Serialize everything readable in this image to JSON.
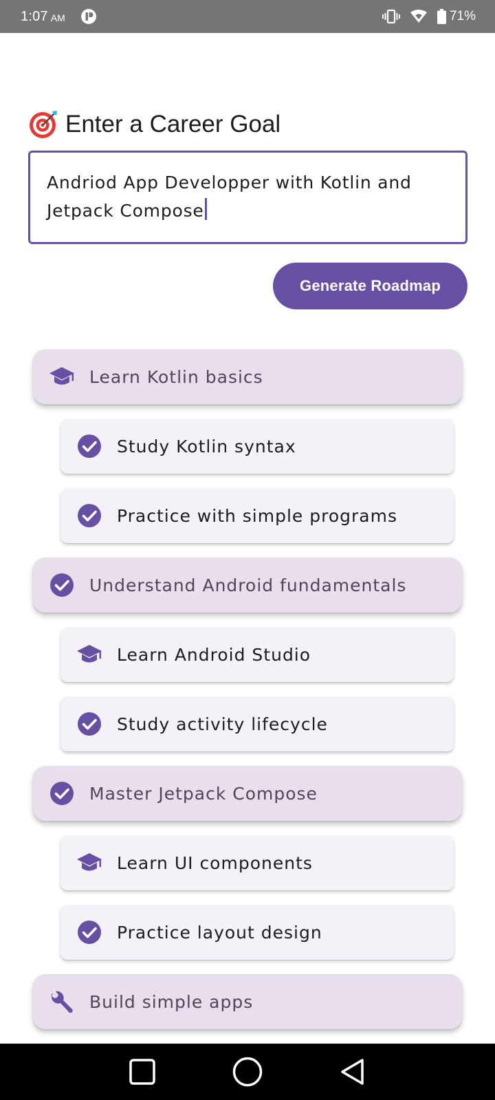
{
  "status_bar": {
    "time": "1:07",
    "ampm": "AM",
    "battery": "71%",
    "icons": [
      "app-notification-icon",
      "vibrate-icon",
      "wifi-icon",
      "battery-icon"
    ]
  },
  "goal": {
    "emoji_icon": "direct-hit-target-icon",
    "title": "Enter a Career Goal",
    "input_value": "Andriod App Developper with Kotlin and Jetpack Compose"
  },
  "actions": {
    "generate_label": "Generate Roadmap"
  },
  "colors": {
    "primary": "#6750a4",
    "main_card_bg": "#e8deec",
    "sub_card_bg": "#f4f1f8",
    "status_bar_bg": "#757575"
  },
  "roadmap": {
    "items": [
      {
        "level": "main",
        "icon": "graduation-cap-icon",
        "label": "Learn Kotlin basics"
      },
      {
        "level": "sub",
        "icon": "check-circle-icon",
        "label": "Study Kotlin syntax"
      },
      {
        "level": "sub",
        "icon": "check-circle-icon",
        "label": "Practice with simple programs"
      },
      {
        "level": "main",
        "icon": "check-circle-icon",
        "label": "Understand Android fundamentals"
      },
      {
        "level": "sub",
        "icon": "graduation-cap-icon",
        "label": "Learn Android Studio"
      },
      {
        "level": "sub",
        "icon": "check-circle-icon",
        "label": "Study activity lifecycle"
      },
      {
        "level": "main",
        "icon": "check-circle-icon",
        "label": "Master Jetpack Compose"
      },
      {
        "level": "sub",
        "icon": "graduation-cap-icon",
        "label": "Learn UI components"
      },
      {
        "level": "sub",
        "icon": "check-circle-icon",
        "label": "Practice layout design"
      },
      {
        "level": "main",
        "icon": "wrench-icon",
        "label": "Build simple apps"
      }
    ]
  },
  "nav_bar": {
    "buttons": [
      "recent-apps-square-icon",
      "home-circle-icon",
      "back-triangle-icon"
    ]
  }
}
